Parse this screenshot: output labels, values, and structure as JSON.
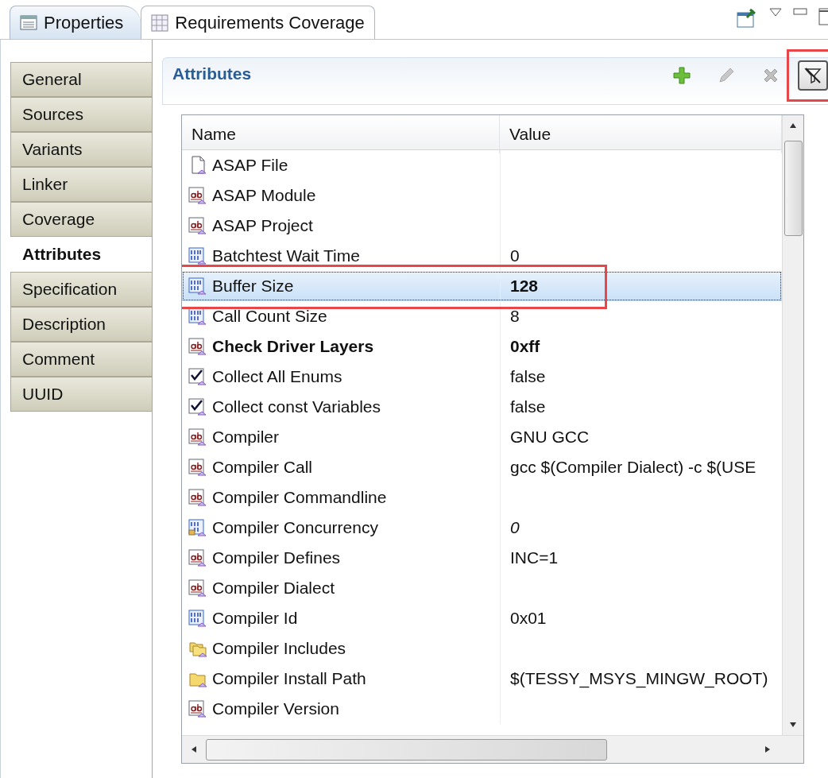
{
  "view_tabs": [
    {
      "label": "Properties",
      "selected": true
    },
    {
      "label": "Requirements Coverage",
      "selected": false
    }
  ],
  "sidebar": {
    "items": [
      {
        "label": "General",
        "selected": false
      },
      {
        "label": "Sources",
        "selected": false
      },
      {
        "label": "Variants",
        "selected": false
      },
      {
        "label": "Linker",
        "selected": false
      },
      {
        "label": "Coverage",
        "selected": false
      },
      {
        "label": "Attributes",
        "selected": true
      },
      {
        "label": "Specification",
        "selected": false
      },
      {
        "label": "Description",
        "selected": false
      },
      {
        "label": "Comment",
        "selected": false
      },
      {
        "label": "UUID",
        "selected": false
      }
    ]
  },
  "section": {
    "title": "Attributes",
    "tools": [
      {
        "kind": "add",
        "disabled": false,
        "pressed": false,
        "highlighted": false
      },
      {
        "kind": "edit",
        "disabled": true,
        "pressed": false,
        "highlighted": false
      },
      {
        "kind": "delete",
        "disabled": true,
        "pressed": false,
        "highlighted": false
      },
      {
        "kind": "filter",
        "disabled": false,
        "pressed": true,
        "highlighted": true
      }
    ]
  },
  "table": {
    "columns": [
      "Name",
      "Value"
    ],
    "rows": [
      {
        "kind": "file",
        "name": "ASAP File",
        "name_bold": false,
        "selected": false,
        "highlighted": false
      },
      {
        "kind": "text",
        "name": "ASAP Module",
        "name_bold": false,
        "selected": false,
        "highlighted": false
      },
      {
        "kind": "text",
        "name": "ASAP Project",
        "name_bold": false,
        "selected": false,
        "highlighted": false
      },
      {
        "kind": "number",
        "name": "Batchtest Wait Time",
        "value": "0",
        "name_bold": false,
        "selected": false,
        "highlighted": false
      },
      {
        "kind": "number",
        "name": "Buffer Size",
        "value": "128",
        "name_bold": false,
        "value_bold": true,
        "selected": true,
        "highlighted": true
      },
      {
        "kind": "number",
        "name": "Call Count Size",
        "value": "8",
        "name_bold": false,
        "selected": false,
        "highlighted": false
      },
      {
        "kind": "text",
        "name": "Check Driver Layers",
        "value": "0xff",
        "name_bold": true,
        "value_bold": true,
        "selected": false,
        "highlighted": false
      },
      {
        "kind": "bool",
        "name": "Collect All Enums",
        "value": "false",
        "name_bold": false,
        "selected": false,
        "highlighted": false
      },
      {
        "kind": "bool",
        "name": "Collect const Variables",
        "value": "false",
        "name_bold": false,
        "selected": false,
        "highlighted": false
      },
      {
        "kind": "text",
        "name": "Compiler",
        "value": "GNU GCC",
        "name_bold": false,
        "selected": false,
        "highlighted": false
      },
      {
        "kind": "text",
        "name": "Compiler Call",
        "value": "gcc $(Compiler Dialect) -c $(USE",
        "name_bold": false,
        "selected": false,
        "highlighted": false
      },
      {
        "kind": "text",
        "name": "Compiler Commandline",
        "name_bold": false,
        "selected": false,
        "highlighted": false
      },
      {
        "kind": "locked-number",
        "name": "Compiler Concurrency",
        "value": "0",
        "name_bold": false,
        "value_italic": true,
        "selected": false,
        "highlighted": false
      },
      {
        "kind": "text",
        "name": "Compiler Defines",
        "value": "INC=1",
        "name_bold": false,
        "selected": false,
        "highlighted": false
      },
      {
        "kind": "text",
        "name": "Compiler Dialect",
        "name_bold": false,
        "selected": false,
        "highlighted": false
      },
      {
        "kind": "number",
        "name": "Compiler Id",
        "value": "0x01",
        "name_bold": false,
        "selected": false,
        "highlighted": false
      },
      {
        "kind": "folders",
        "name": "Compiler Includes",
        "name_bold": false,
        "selected": false,
        "highlighted": false
      },
      {
        "kind": "folder",
        "name": "Compiler Install Path",
        "value": "$(TESSY_MSYS_MINGW_ROOT)",
        "name_bold": false,
        "selected": false,
        "highlighted": false
      },
      {
        "kind": "text",
        "name": "Compiler Version",
        "name_bold": false,
        "selected": false,
        "highlighted": false
      }
    ]
  }
}
